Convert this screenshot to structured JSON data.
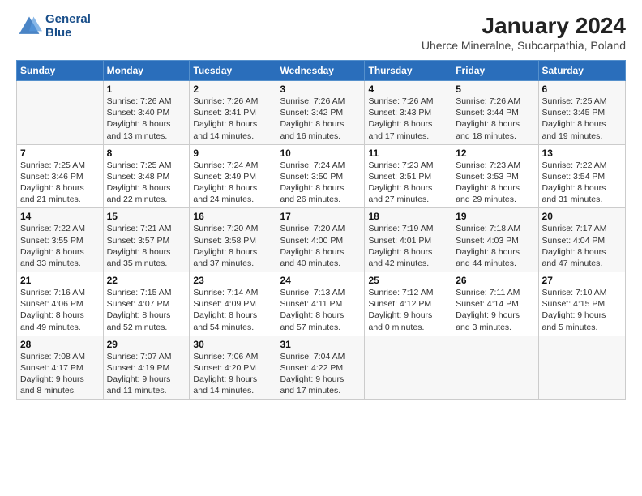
{
  "logo": {
    "line1": "General",
    "line2": "Blue"
  },
  "title": "January 2024",
  "subtitle": "Uherce Mineralne, Subcarpathia, Poland",
  "days_header": [
    "Sunday",
    "Monday",
    "Tuesday",
    "Wednesday",
    "Thursday",
    "Friday",
    "Saturday"
  ],
  "weeks": [
    [
      {
        "day": "",
        "lines": []
      },
      {
        "day": "1",
        "lines": [
          "Sunrise: 7:26 AM",
          "Sunset: 3:40 PM",
          "Daylight: 8 hours",
          "and 13 minutes."
        ]
      },
      {
        "day": "2",
        "lines": [
          "Sunrise: 7:26 AM",
          "Sunset: 3:41 PM",
          "Daylight: 8 hours",
          "and 14 minutes."
        ]
      },
      {
        "day": "3",
        "lines": [
          "Sunrise: 7:26 AM",
          "Sunset: 3:42 PM",
          "Daylight: 8 hours",
          "and 16 minutes."
        ]
      },
      {
        "day": "4",
        "lines": [
          "Sunrise: 7:26 AM",
          "Sunset: 3:43 PM",
          "Daylight: 8 hours",
          "and 17 minutes."
        ]
      },
      {
        "day": "5",
        "lines": [
          "Sunrise: 7:26 AM",
          "Sunset: 3:44 PM",
          "Daylight: 8 hours",
          "and 18 minutes."
        ]
      },
      {
        "day": "6",
        "lines": [
          "Sunrise: 7:25 AM",
          "Sunset: 3:45 PM",
          "Daylight: 8 hours",
          "and 19 minutes."
        ]
      }
    ],
    [
      {
        "day": "7",
        "lines": [
          "Sunrise: 7:25 AM",
          "Sunset: 3:46 PM",
          "Daylight: 8 hours",
          "and 21 minutes."
        ]
      },
      {
        "day": "8",
        "lines": [
          "Sunrise: 7:25 AM",
          "Sunset: 3:48 PM",
          "Daylight: 8 hours",
          "and 22 minutes."
        ]
      },
      {
        "day": "9",
        "lines": [
          "Sunrise: 7:24 AM",
          "Sunset: 3:49 PM",
          "Daylight: 8 hours",
          "and 24 minutes."
        ]
      },
      {
        "day": "10",
        "lines": [
          "Sunrise: 7:24 AM",
          "Sunset: 3:50 PM",
          "Daylight: 8 hours",
          "and 26 minutes."
        ]
      },
      {
        "day": "11",
        "lines": [
          "Sunrise: 7:23 AM",
          "Sunset: 3:51 PM",
          "Daylight: 8 hours",
          "and 27 minutes."
        ]
      },
      {
        "day": "12",
        "lines": [
          "Sunrise: 7:23 AM",
          "Sunset: 3:53 PM",
          "Daylight: 8 hours",
          "and 29 minutes."
        ]
      },
      {
        "day": "13",
        "lines": [
          "Sunrise: 7:22 AM",
          "Sunset: 3:54 PM",
          "Daylight: 8 hours",
          "and 31 minutes."
        ]
      }
    ],
    [
      {
        "day": "14",
        "lines": [
          "Sunrise: 7:22 AM",
          "Sunset: 3:55 PM",
          "Daylight: 8 hours",
          "and 33 minutes."
        ]
      },
      {
        "day": "15",
        "lines": [
          "Sunrise: 7:21 AM",
          "Sunset: 3:57 PM",
          "Daylight: 8 hours",
          "and 35 minutes."
        ]
      },
      {
        "day": "16",
        "lines": [
          "Sunrise: 7:20 AM",
          "Sunset: 3:58 PM",
          "Daylight: 8 hours",
          "and 37 minutes."
        ]
      },
      {
        "day": "17",
        "lines": [
          "Sunrise: 7:20 AM",
          "Sunset: 4:00 PM",
          "Daylight: 8 hours",
          "and 40 minutes."
        ]
      },
      {
        "day": "18",
        "lines": [
          "Sunrise: 7:19 AM",
          "Sunset: 4:01 PM",
          "Daylight: 8 hours",
          "and 42 minutes."
        ]
      },
      {
        "day": "19",
        "lines": [
          "Sunrise: 7:18 AM",
          "Sunset: 4:03 PM",
          "Daylight: 8 hours",
          "and 44 minutes."
        ]
      },
      {
        "day": "20",
        "lines": [
          "Sunrise: 7:17 AM",
          "Sunset: 4:04 PM",
          "Daylight: 8 hours",
          "and 47 minutes."
        ]
      }
    ],
    [
      {
        "day": "21",
        "lines": [
          "Sunrise: 7:16 AM",
          "Sunset: 4:06 PM",
          "Daylight: 8 hours",
          "and 49 minutes."
        ]
      },
      {
        "day": "22",
        "lines": [
          "Sunrise: 7:15 AM",
          "Sunset: 4:07 PM",
          "Daylight: 8 hours",
          "and 52 minutes."
        ]
      },
      {
        "day": "23",
        "lines": [
          "Sunrise: 7:14 AM",
          "Sunset: 4:09 PM",
          "Daylight: 8 hours",
          "and 54 minutes."
        ]
      },
      {
        "day": "24",
        "lines": [
          "Sunrise: 7:13 AM",
          "Sunset: 4:11 PM",
          "Daylight: 8 hours",
          "and 57 minutes."
        ]
      },
      {
        "day": "25",
        "lines": [
          "Sunrise: 7:12 AM",
          "Sunset: 4:12 PM",
          "Daylight: 9 hours",
          "and 0 minutes."
        ]
      },
      {
        "day": "26",
        "lines": [
          "Sunrise: 7:11 AM",
          "Sunset: 4:14 PM",
          "Daylight: 9 hours",
          "and 3 minutes."
        ]
      },
      {
        "day": "27",
        "lines": [
          "Sunrise: 7:10 AM",
          "Sunset: 4:15 PM",
          "Daylight: 9 hours",
          "and 5 minutes."
        ]
      }
    ],
    [
      {
        "day": "28",
        "lines": [
          "Sunrise: 7:08 AM",
          "Sunset: 4:17 PM",
          "Daylight: 9 hours",
          "and 8 minutes."
        ]
      },
      {
        "day": "29",
        "lines": [
          "Sunrise: 7:07 AM",
          "Sunset: 4:19 PM",
          "Daylight: 9 hours",
          "and 11 minutes."
        ]
      },
      {
        "day": "30",
        "lines": [
          "Sunrise: 7:06 AM",
          "Sunset: 4:20 PM",
          "Daylight: 9 hours",
          "and 14 minutes."
        ]
      },
      {
        "day": "31",
        "lines": [
          "Sunrise: 7:04 AM",
          "Sunset: 4:22 PM",
          "Daylight: 9 hours",
          "and 17 minutes."
        ]
      },
      {
        "day": "",
        "lines": []
      },
      {
        "day": "",
        "lines": []
      },
      {
        "day": "",
        "lines": []
      }
    ]
  ]
}
